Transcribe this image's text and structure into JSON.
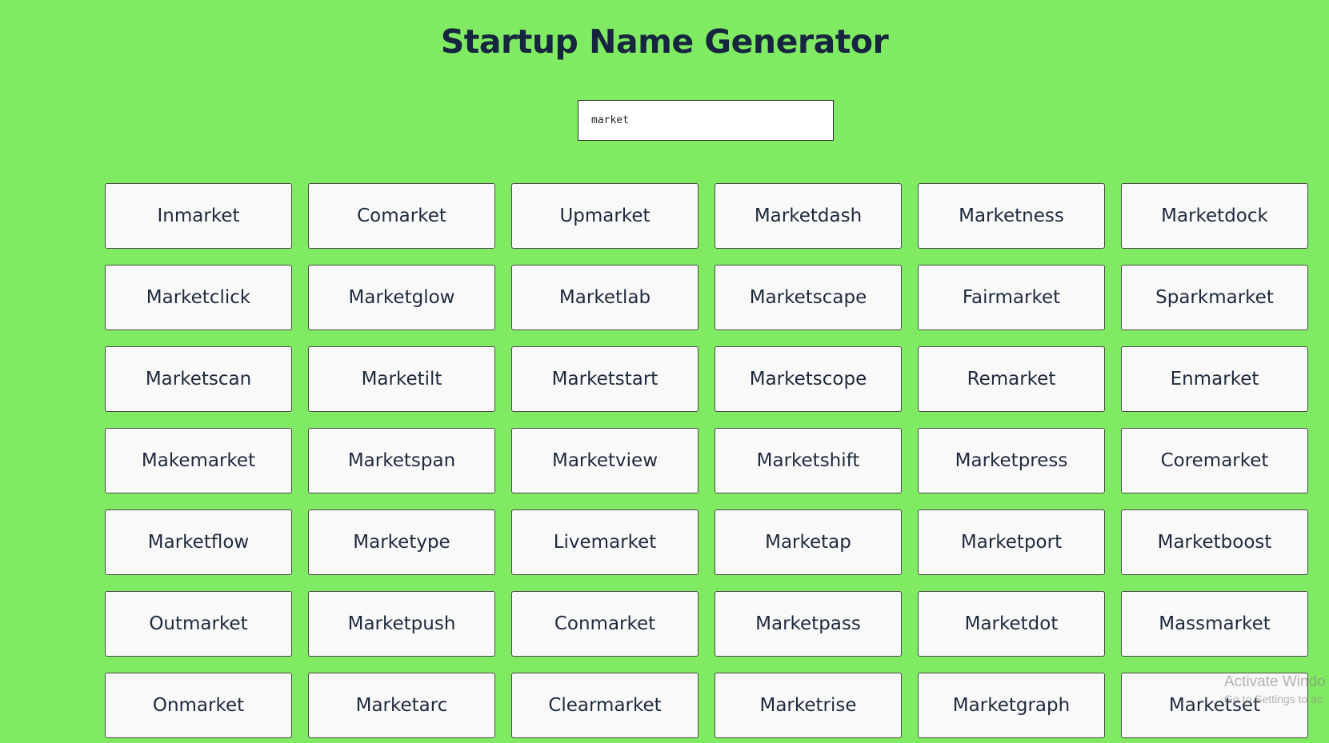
{
  "page": {
    "title": "Startup Name Generator"
  },
  "search": {
    "value": "market"
  },
  "names": [
    "Inmarket",
    "Comarket",
    "Upmarket",
    "Marketdash",
    "Marketness",
    "Marketdock",
    "Marketclick",
    "Marketglow",
    "Marketlab",
    "Marketscape",
    "Fairmarket",
    "Sparkmarket",
    "Marketscan",
    "Marketilt",
    "Marketstart",
    "Marketscope",
    "Remarket",
    "Enmarket",
    "Makemarket",
    "Marketspan",
    "Marketview",
    "Marketshift",
    "Marketpress",
    "Coremarket",
    "Marketflow",
    "Marketype",
    "Livemarket",
    "Marketap",
    "Marketport",
    "Marketboost",
    "Outmarket",
    "Marketpush",
    "Conmarket",
    "Marketpass",
    "Marketdot",
    "Massmarket",
    "Onmarket",
    "Marketarc",
    "Clearmarket",
    "Marketrise",
    "Marketgraph",
    "Marketset"
  ],
  "watermark": {
    "line1": "Activate Windo",
    "line2": "Go to Settings to ac"
  },
  "colors": {
    "background": "#80eb62",
    "title": "#16263f",
    "card_background": "#f9f9f9",
    "card_text": "#1f2a3d"
  }
}
